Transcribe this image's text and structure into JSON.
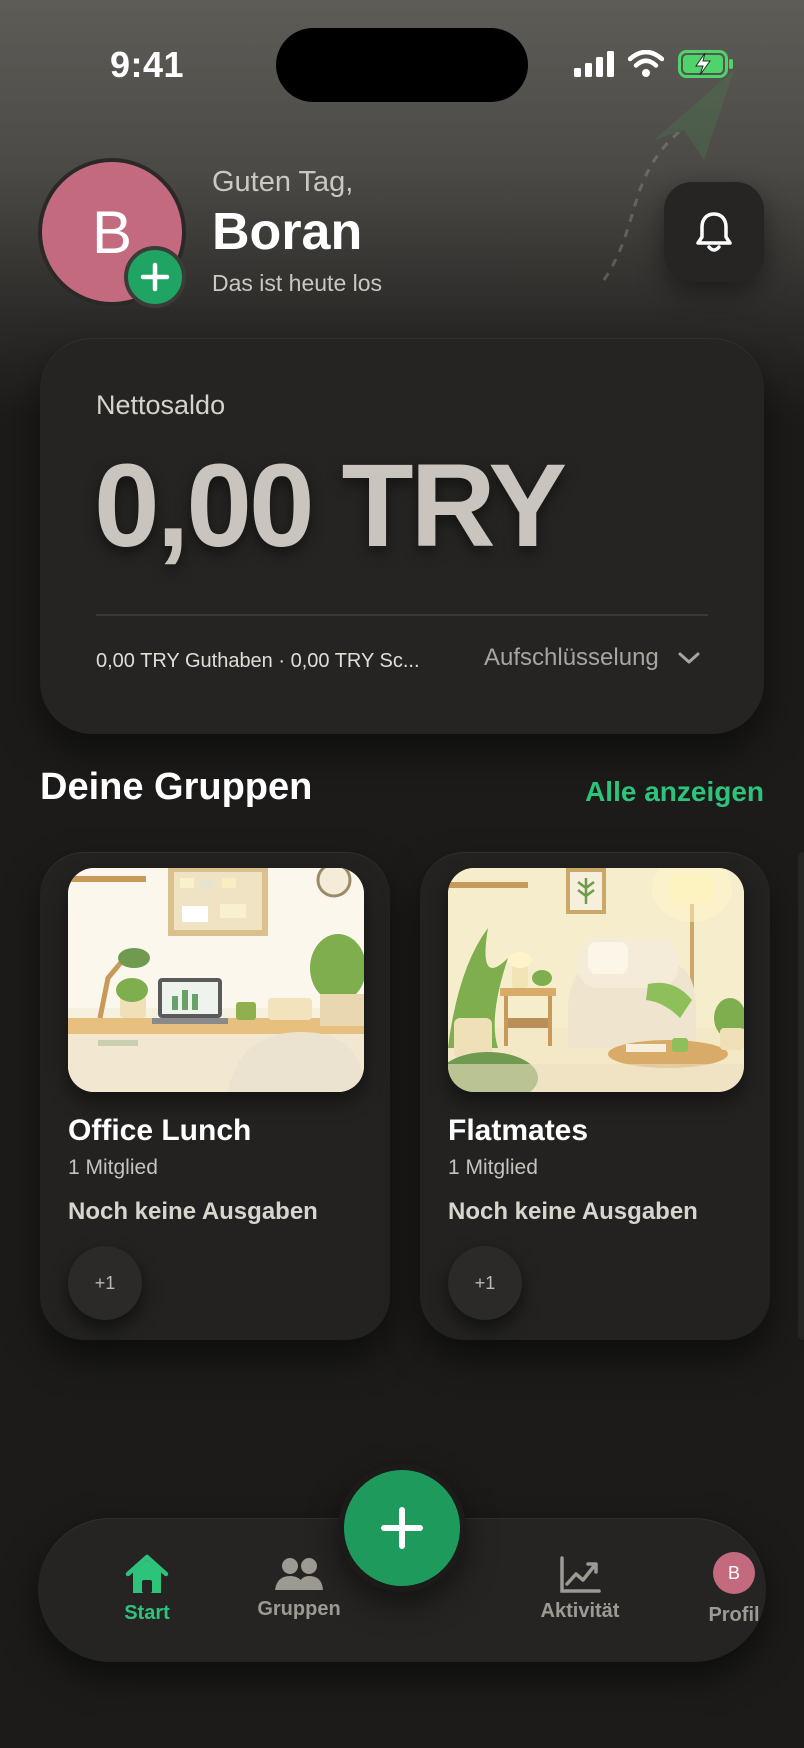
{
  "status_bar": {
    "time": "9:41"
  },
  "header": {
    "avatar_initial": "B",
    "greeting": "Guten Tag,",
    "name": "Boran",
    "subtitle": "Das ist heute los"
  },
  "balance": {
    "label": "Nettosaldo",
    "amount": "0,00 TRY",
    "detail": "0,00 TRY Guthaben · 0,00 TRY Sc...",
    "breakdown_label": "Aufschlüsselung"
  },
  "groups": {
    "title": "Deine Gruppen",
    "show_all": "Alle anzeigen",
    "items": [
      {
        "name": "Office Lunch",
        "members": "1 Mitglied",
        "status": "Noch keine Ausgaben",
        "chip": "+1"
      },
      {
        "name": "Flatmates",
        "members": "1 Mitglied",
        "status": "Noch keine Ausgaben",
        "chip": "+1"
      }
    ]
  },
  "nav": {
    "items": [
      {
        "label": "Start",
        "icon": "home-icon",
        "active": true
      },
      {
        "label": "Gruppen",
        "icon": "people-icon",
        "active": false
      },
      {
        "label": "Aktivität",
        "icon": "chart-line-icon",
        "active": false
      },
      {
        "label": "Profil",
        "icon": "avatar",
        "avatar_initial": "B",
        "active": false
      }
    ]
  },
  "colors": {
    "accent": "#2ec37a",
    "fab": "#1e9a5c",
    "avatar": "#c46a7e",
    "background": "#1c1b1a",
    "card": "#252423"
  }
}
